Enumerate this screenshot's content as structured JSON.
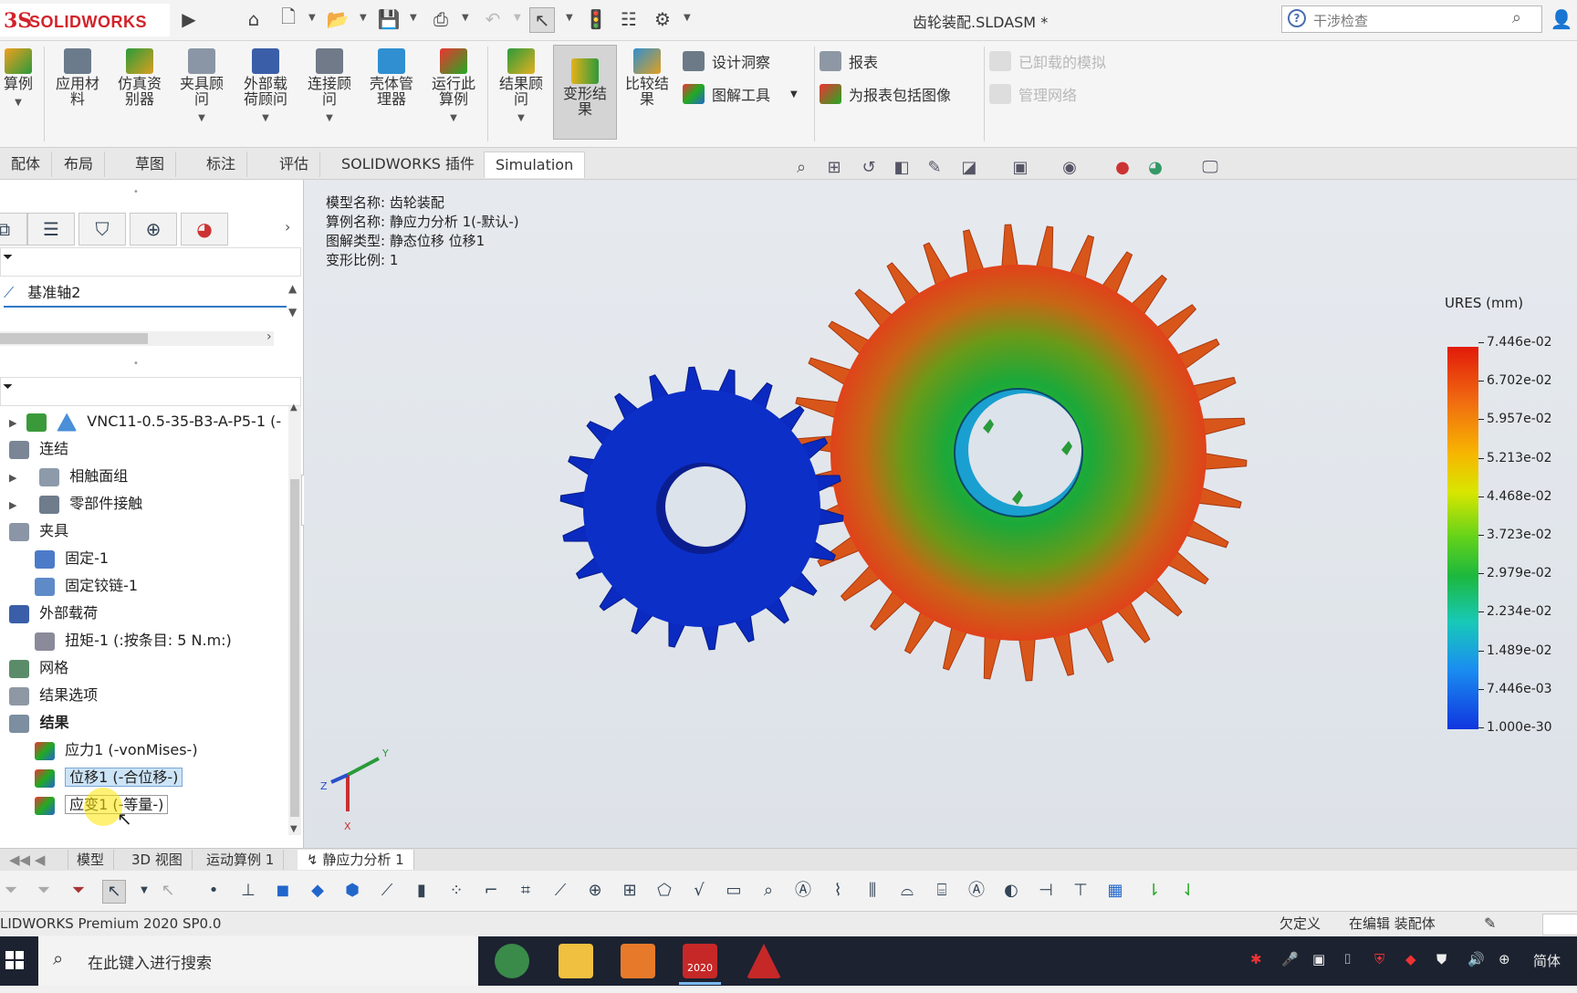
{
  "app": {
    "brand_ds": "3S",
    "brand_name": "SOLIDWORKS",
    "document_title": "齿轮装配.SLDASM *"
  },
  "search": {
    "placeholder": "干涉检查"
  },
  "ribbon": {
    "buttons": [
      {
        "label": "算例"
      },
      {
        "label": "应用材\n料"
      },
      {
        "label": "仿真资\n别器"
      },
      {
        "label": "夹具顾\n问"
      },
      {
        "label": "外部载\n荷顾问"
      },
      {
        "label": "连接顾\n问"
      },
      {
        "label": "壳体管\n理器"
      },
      {
        "label": "运行此\n算例"
      },
      {
        "label": "结果顾\n问"
      },
      {
        "label": "变形结\n果"
      },
      {
        "label": "比较结\n果"
      }
    ],
    "small": {
      "design_insight": "设计洞察",
      "plot_tools": "图解工具",
      "report": "报表",
      "include_image": "为报表包括图像",
      "unloaded_sim": "已卸载的模拟",
      "manage_network": "管理网络"
    }
  },
  "tabs": [
    "配体",
    "布局",
    "草图",
    "标注",
    "评估",
    "SOLIDWORKS 插件",
    "Simulation"
  ],
  "left_panel": {
    "axis_item": "基准轴2",
    "tree": {
      "part": "VNC11-0.5-35-B3-A-P5-1 (-",
      "connections": "连结",
      "contact_set": "相触面组",
      "component_contact": "零部件接触",
      "fixtures": "夹具",
      "fixed": "固定-1",
      "fixed_hinge": "固定铰链-1",
      "external_loads": "外部载荷",
      "torque": "扭矩-1 (:按条目: 5 N.m:)",
      "mesh": "网格",
      "result_options": "结果选项",
      "results": "结果",
      "stress": "应力1 (-vonMises-)",
      "displacement": "位移1 (-合位移-)",
      "strain": "应变1 (-等量-)"
    }
  },
  "viewport": {
    "model_name": "模型名称: 齿轮装配",
    "study_name": "算例名称: 静应力分析 1(-默认-)",
    "plot_type": "图解类型: 静态位移 位移1",
    "deform_scale": "变形比例: 1",
    "legend": {
      "title": "URES (mm)",
      "values": [
        "7.446e-02",
        "6.702e-02",
        "5.957e-02",
        "5.213e-02",
        "4.468e-02",
        "3.723e-02",
        "2.979e-02",
        "2.234e-02",
        "1.489e-02",
        "7.446e-03",
        "1.000e-30"
      ]
    },
    "axis_labels": {
      "x": "X",
      "y": "Y",
      "z": "Z"
    }
  },
  "bottom_tabs": [
    "模型",
    "3D 视图",
    "运动算例 1",
    "静应力分析 1"
  ],
  "status": {
    "product": "LIDWORKS Premium 2020 SP0.0",
    "under_defined": "欠定义",
    "editing": "在编辑 装配体"
  },
  "taskbar": {
    "search_placeholder": "在此键入进行搜索",
    "lang": "简体",
    "sw_badge": "2020"
  },
  "colors": {
    "accent_red": "#d2232a",
    "legend_max": "#e21a0a",
    "legend_min": "#1036e0"
  }
}
